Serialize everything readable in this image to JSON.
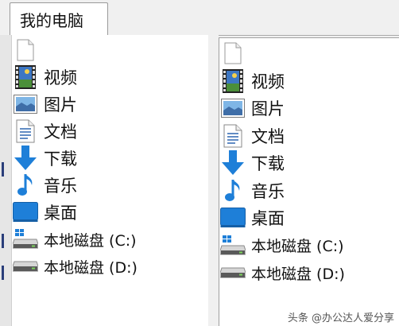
{
  "tab": {
    "label": "我的电脑"
  },
  "left_pane": {
    "items": [
      {
        "label": "",
        "icon": "blank-file-icon"
      },
      {
        "label": "视频",
        "icon": "video-icon"
      },
      {
        "label": "图片",
        "icon": "picture-icon"
      },
      {
        "label": "文档",
        "icon": "document-icon"
      },
      {
        "label": "下载",
        "icon": "download-arrow-icon"
      },
      {
        "label": "音乐",
        "icon": "music-note-icon"
      },
      {
        "label": "桌面",
        "icon": "desktop-icon"
      },
      {
        "label": "本地磁盘 (C:)",
        "icon": "system-drive-icon"
      },
      {
        "label": "本地磁盘 (D:)",
        "icon": "drive-icon"
      }
    ]
  },
  "right_pane": {
    "items": [
      {
        "label": "",
        "icon": "blank-file-icon"
      },
      {
        "label": "视频",
        "icon": "video-icon"
      },
      {
        "label": "图片",
        "icon": "picture-icon"
      },
      {
        "label": "文档",
        "icon": "document-icon"
      },
      {
        "label": "下载",
        "icon": "download-arrow-icon"
      },
      {
        "label": "音乐",
        "icon": "music-note-icon"
      },
      {
        "label": "桌面",
        "icon": "desktop-icon"
      },
      {
        "label": "本地磁盘 (C:)",
        "icon": "system-drive-icon"
      },
      {
        "label": "本地磁盘 (D:)",
        "icon": "drive-icon"
      }
    ]
  },
  "watermark": "头条 @办公达人爱分享",
  "colors": {
    "accent_blue": "#1e7fd8",
    "selection_blue": "#2a3e7a",
    "pane_bg": "#ffffff",
    "chrome_bg": "#f0f0f0"
  }
}
